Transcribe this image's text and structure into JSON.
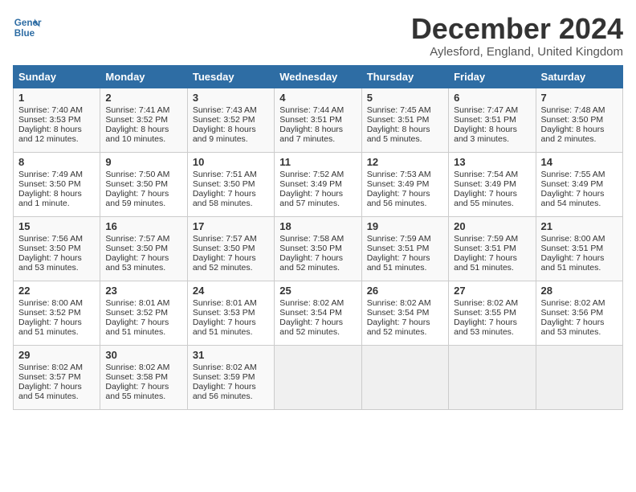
{
  "header": {
    "logo_line1": "General",
    "logo_line2": "Blue",
    "month": "December 2024",
    "location": "Aylesford, England, United Kingdom"
  },
  "days_of_week": [
    "Sunday",
    "Monday",
    "Tuesday",
    "Wednesday",
    "Thursday",
    "Friday",
    "Saturday"
  ],
  "weeks": [
    [
      {
        "day": 1,
        "sunrise": "7:40 AM",
        "sunset": "3:53 PM",
        "daylight": "8 hours and 12 minutes."
      },
      {
        "day": 2,
        "sunrise": "7:41 AM",
        "sunset": "3:52 PM",
        "daylight": "8 hours and 10 minutes."
      },
      {
        "day": 3,
        "sunrise": "7:43 AM",
        "sunset": "3:52 PM",
        "daylight": "8 hours and 9 minutes."
      },
      {
        "day": 4,
        "sunrise": "7:44 AM",
        "sunset": "3:51 PM",
        "daylight": "8 hours and 7 minutes."
      },
      {
        "day": 5,
        "sunrise": "7:45 AM",
        "sunset": "3:51 PM",
        "daylight": "8 hours and 5 minutes."
      },
      {
        "day": 6,
        "sunrise": "7:47 AM",
        "sunset": "3:51 PM",
        "daylight": "8 hours and 3 minutes."
      },
      {
        "day": 7,
        "sunrise": "7:48 AM",
        "sunset": "3:50 PM",
        "daylight": "8 hours and 2 minutes."
      }
    ],
    [
      {
        "day": 8,
        "sunrise": "7:49 AM",
        "sunset": "3:50 PM",
        "daylight": "8 hours and 1 minute."
      },
      {
        "day": 9,
        "sunrise": "7:50 AM",
        "sunset": "3:50 PM",
        "daylight": "7 hours and 59 minutes."
      },
      {
        "day": 10,
        "sunrise": "7:51 AM",
        "sunset": "3:50 PM",
        "daylight": "7 hours and 58 minutes."
      },
      {
        "day": 11,
        "sunrise": "7:52 AM",
        "sunset": "3:49 PM",
        "daylight": "7 hours and 57 minutes."
      },
      {
        "day": 12,
        "sunrise": "7:53 AM",
        "sunset": "3:49 PM",
        "daylight": "7 hours and 56 minutes."
      },
      {
        "day": 13,
        "sunrise": "7:54 AM",
        "sunset": "3:49 PM",
        "daylight": "7 hours and 55 minutes."
      },
      {
        "day": 14,
        "sunrise": "7:55 AM",
        "sunset": "3:49 PM",
        "daylight": "7 hours and 54 minutes."
      }
    ],
    [
      {
        "day": 15,
        "sunrise": "7:56 AM",
        "sunset": "3:50 PM",
        "daylight": "7 hours and 53 minutes."
      },
      {
        "day": 16,
        "sunrise": "7:57 AM",
        "sunset": "3:50 PM",
        "daylight": "7 hours and 53 minutes."
      },
      {
        "day": 17,
        "sunrise": "7:57 AM",
        "sunset": "3:50 PM",
        "daylight": "7 hours and 52 minutes."
      },
      {
        "day": 18,
        "sunrise": "7:58 AM",
        "sunset": "3:50 PM",
        "daylight": "7 hours and 52 minutes."
      },
      {
        "day": 19,
        "sunrise": "7:59 AM",
        "sunset": "3:51 PM",
        "daylight": "7 hours and 51 minutes."
      },
      {
        "day": 20,
        "sunrise": "7:59 AM",
        "sunset": "3:51 PM",
        "daylight": "7 hours and 51 minutes."
      },
      {
        "day": 21,
        "sunrise": "8:00 AM",
        "sunset": "3:51 PM",
        "daylight": "7 hours and 51 minutes."
      }
    ],
    [
      {
        "day": 22,
        "sunrise": "8:00 AM",
        "sunset": "3:52 PM",
        "daylight": "7 hours and 51 minutes."
      },
      {
        "day": 23,
        "sunrise": "8:01 AM",
        "sunset": "3:52 PM",
        "daylight": "7 hours and 51 minutes."
      },
      {
        "day": 24,
        "sunrise": "8:01 AM",
        "sunset": "3:53 PM",
        "daylight": "7 hours and 51 minutes."
      },
      {
        "day": 25,
        "sunrise": "8:02 AM",
        "sunset": "3:54 PM",
        "daylight": "7 hours and 52 minutes."
      },
      {
        "day": 26,
        "sunrise": "8:02 AM",
        "sunset": "3:54 PM",
        "daylight": "7 hours and 52 minutes."
      },
      {
        "day": 27,
        "sunrise": "8:02 AM",
        "sunset": "3:55 PM",
        "daylight": "7 hours and 53 minutes."
      },
      {
        "day": 28,
        "sunrise": "8:02 AM",
        "sunset": "3:56 PM",
        "daylight": "7 hours and 53 minutes."
      }
    ],
    [
      {
        "day": 29,
        "sunrise": "8:02 AM",
        "sunset": "3:57 PM",
        "daylight": "7 hours and 54 minutes."
      },
      {
        "day": 30,
        "sunrise": "8:02 AM",
        "sunset": "3:58 PM",
        "daylight": "7 hours and 55 minutes."
      },
      {
        "day": 31,
        "sunrise": "8:02 AM",
        "sunset": "3:59 PM",
        "daylight": "7 hours and 56 minutes."
      },
      null,
      null,
      null,
      null
    ]
  ]
}
